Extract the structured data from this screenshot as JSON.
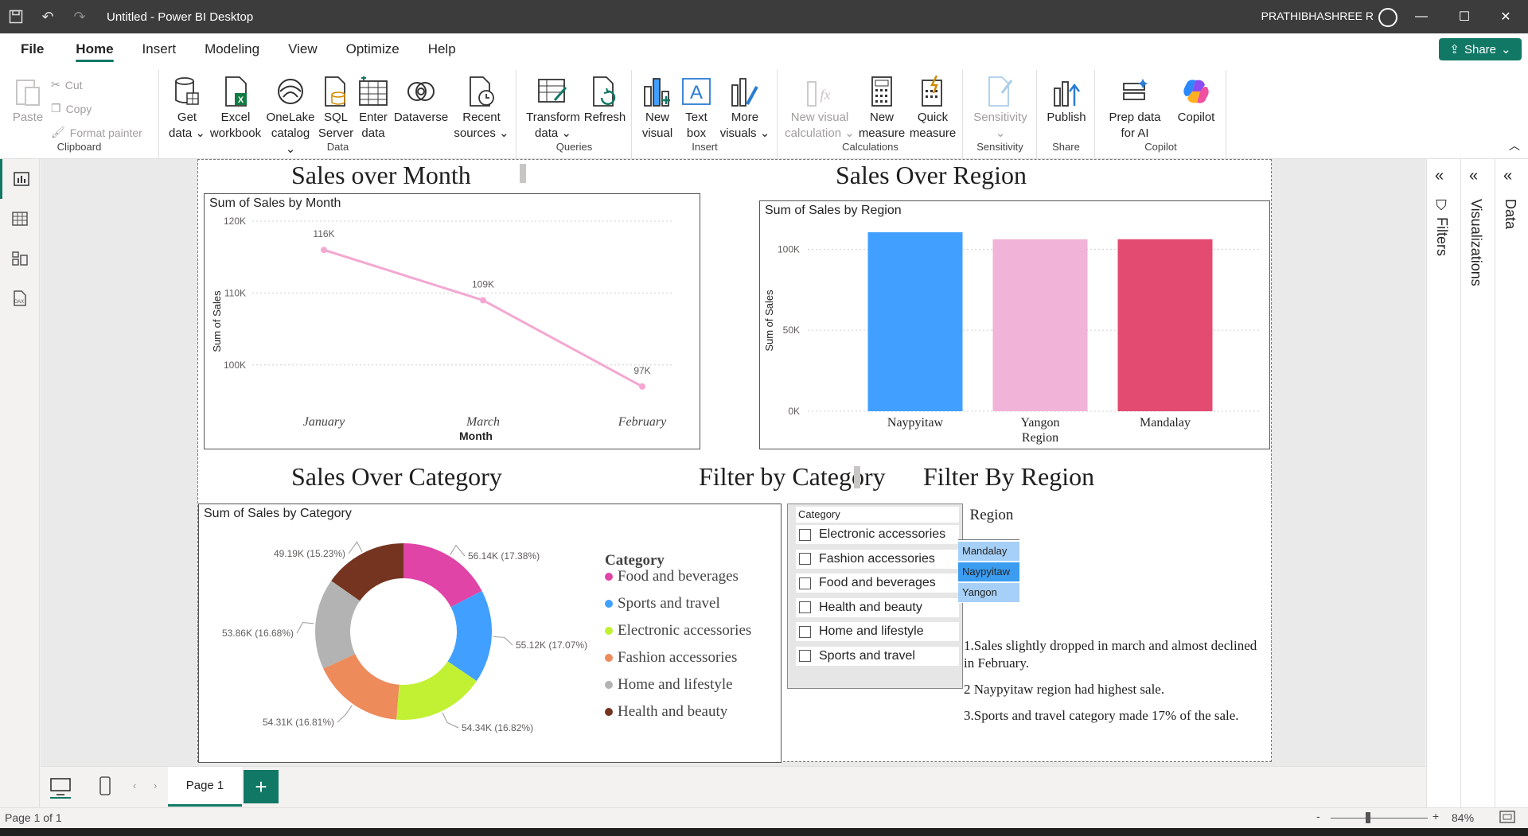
{
  "titlebar": {
    "title": "Untitled - Power BI Desktop",
    "user": "PRATHIBHASHREE R"
  },
  "menu": {
    "file": "File",
    "tabs": [
      "Home",
      "Insert",
      "Modeling",
      "View",
      "Optimize",
      "Help"
    ],
    "share": "Share"
  },
  "ribbon": {
    "clipboard": {
      "label": "Clipboard",
      "paste": "Paste",
      "cut": "Cut",
      "copy": "Copy",
      "format_painter": "Format painter"
    },
    "data": {
      "label": "Data",
      "get_data": "Get data",
      "excel": "Excel workbook",
      "onelake": "OneLake catalog",
      "sql": "SQL Server",
      "enter": "Enter data",
      "dataverse": "Dataverse",
      "recent": "Recent sources"
    },
    "queries": {
      "label": "Queries",
      "transform": "Transform data",
      "refresh": "Refresh"
    },
    "insert": {
      "label": "Insert",
      "new_visual": "New visual",
      "text_box": "Text box",
      "more_visuals": "More visuals"
    },
    "calculations": {
      "label": "Calculations",
      "new_visual_calc": "New visual calculation",
      "new_measure": "New measure",
      "quick_measure": "Quick measure"
    },
    "sensitivity": {
      "label": "Sensitivity",
      "sensitivity": "Sensitivity"
    },
    "share": {
      "label": "Share",
      "publish": "Publish"
    },
    "copilot": {
      "label": "Copilot",
      "prep": "Prep data for AI",
      "copilot": "Copilot"
    }
  },
  "report": {
    "titles": {
      "month": "Sales over Month",
      "region": "Sales Over Region",
      "category": "Sales  Over Category",
      "filter_category": "Filter by Category",
      "filter_region": "Filter By Region"
    },
    "line_visual": {
      "header": "Sum of Sales by Month",
      "ylabel": "Sum of Sales",
      "xlabel": "Month"
    },
    "bar_visual": {
      "header": "Sum of Sales by Region",
      "ylabel": "Sum of Sales",
      "xlabel": "Region"
    },
    "donut_visual": {
      "header": "Sum of Sales by Category",
      "legend_title": "Category"
    },
    "slicer_category": {
      "header": "Category",
      "items": [
        "Electronic accessories",
        "Fashion accessories",
        "Food and beverages",
        "Health and beauty",
        "Home and lifestyle",
        "Sports and travel"
      ]
    },
    "slicer_region": {
      "header": "Region",
      "items": [
        "Mandalay",
        "Naypyitaw",
        "Yangon"
      ],
      "selected": "Naypyitaw"
    },
    "notes": [
      "1.Sales slightly dropped in march and almost declined in February.",
      "2 Naypyitaw region had highest sale.",
      "3.Sports and travel category made 17% of the sale."
    ]
  },
  "panes": {
    "filters": "Filters",
    "visualizations": "Visualizations",
    "data": "Data"
  },
  "pagebar": {
    "page_tab": "Page 1"
  },
  "status": {
    "page": "Page 1 of 1",
    "zoom": "84%"
  },
  "colors": {
    "accent": "#117865",
    "pink_line": "#f4a7d1",
    "blue": "#41a0ff",
    "pink": "#f1b3d8",
    "crimson": "#e34b71"
  },
  "chart_data": [
    {
      "type": "line",
      "title": "Sum of Sales by Month",
      "categories": [
        "January",
        "March",
        "February"
      ],
      "values": [
        116000,
        109000,
        97000
      ],
      "labels": [
        "116K",
        "109K",
        "97K"
      ],
      "yticks": [
        "100K",
        "110K",
        "120K"
      ],
      "xlabel": "Month",
      "ylabel": "Sum of Sales",
      "ylim": [
        95000,
        121000
      ]
    },
    {
      "type": "bar",
      "title": "Sum of Sales by Region",
      "categories": [
        "Naypyitaw",
        "Yangon",
        "Mandalay"
      ],
      "values": [
        110500,
        106200,
        106200
      ],
      "colors": [
        "#41a0ff",
        "#f1b3d8",
        "#e34b71"
      ],
      "yticks": [
        "0K",
        "50K",
        "100K"
      ],
      "xlabel": "Region",
      "ylabel": "Sum of Sales",
      "ylim": [
        0,
        110000
      ]
    },
    {
      "type": "pie",
      "title": "Sum of Sales by Category",
      "categories": [
        "Food and beverages",
        "Sports and travel",
        "Electronic accessories",
        "Fashion accessories",
        "Home and lifestyle",
        "Health and beauty"
      ],
      "values": [
        56.14,
        55.12,
        54.34,
        54.31,
        53.86,
        49.19
      ],
      "labels": [
        "56.14K (17.38%)",
        "55.12K (17.07%)",
        "54.34K (16.82%)",
        "54.31K (16.81%)",
        "53.86K (16.68%)",
        "49.19K (15.23%)"
      ],
      "colors": [
        "#e044a7",
        "#41a0ff",
        "#c1f132",
        "#ed8b5b",
        "#b3b3b3",
        "#743420"
      ],
      "legend_title": "Category"
    }
  ]
}
